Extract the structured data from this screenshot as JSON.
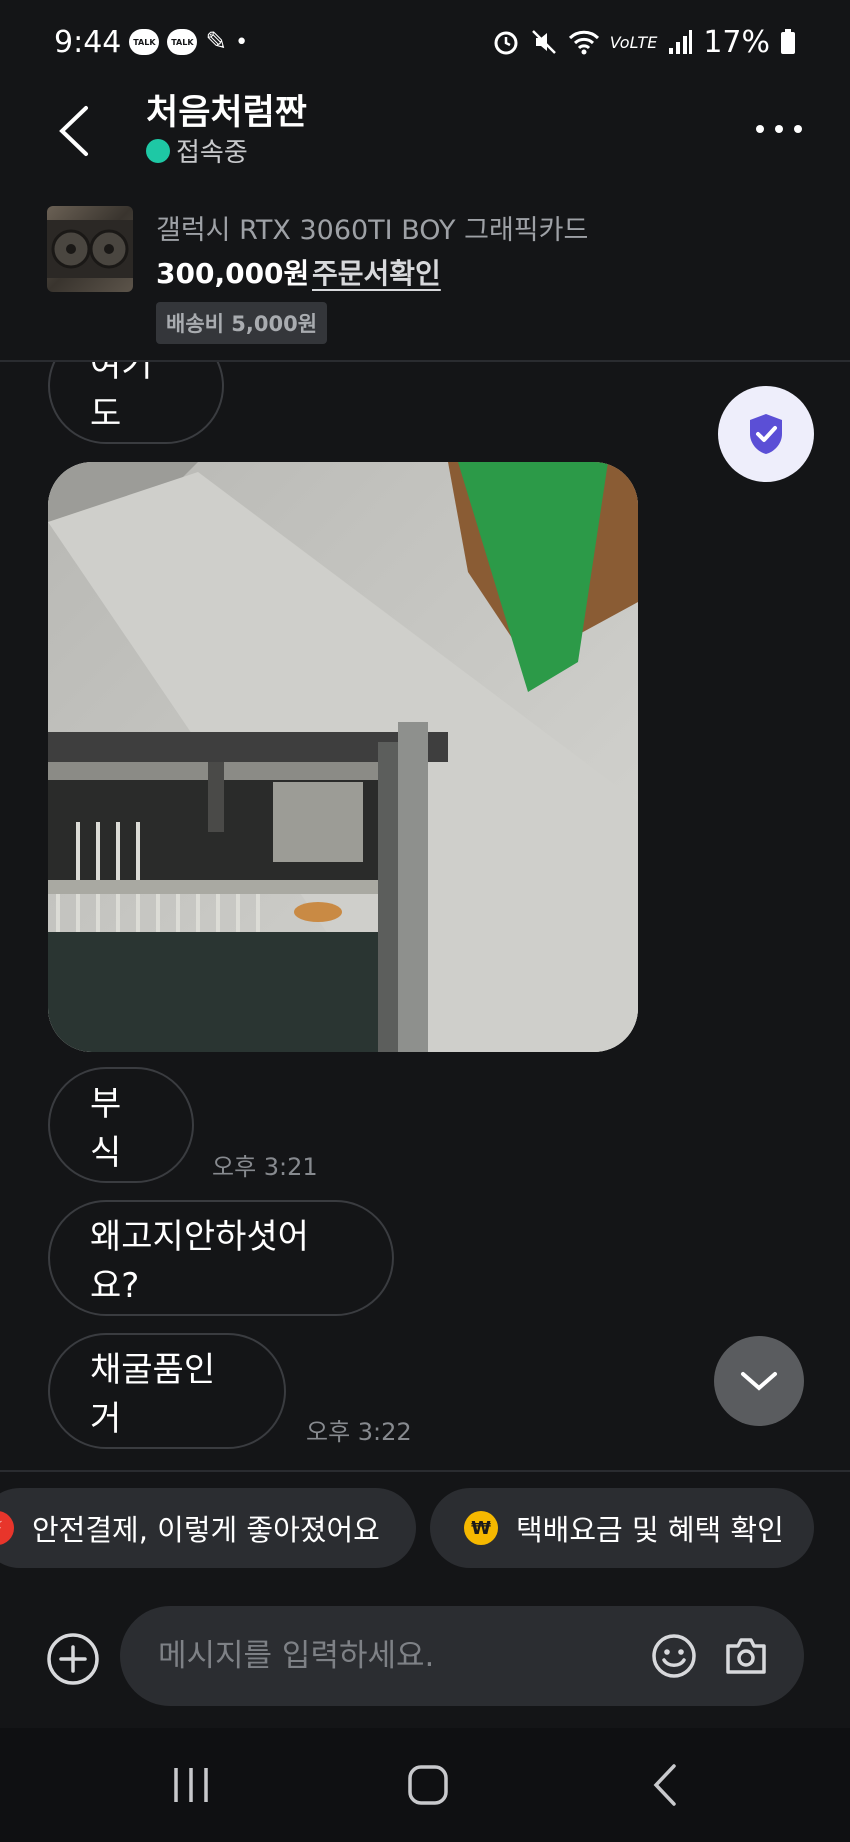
{
  "status_bar": {
    "time": "9:44",
    "notification_badges": [
      "TALK",
      "TALK"
    ],
    "dot": "•",
    "battery": "17%",
    "icons": [
      "alarm-icon",
      "mute-icon",
      "wifi-icon",
      "volte-icon",
      "signal-icon",
      "battery-icon"
    ]
  },
  "header": {
    "title": "처음처럼짠",
    "online_status": "접속중",
    "online_color": "#1ec8a5"
  },
  "product": {
    "name": "갤럭시 RTX 3060TI BOY 그래픽카드",
    "price": "300,000원",
    "order_link": "주문서확인",
    "shipping": "배송비 5,000원"
  },
  "messages": [
    {
      "text": "여기도"
    },
    {
      "text": "부식",
      "time": "오후 3:21"
    },
    {
      "text": "왜고지안하셧어요?"
    },
    {
      "text": "채굴품인거",
      "time": "오후 3:22"
    }
  ],
  "chips": [
    {
      "icon": "lightning-icon",
      "label": "안전결제, 이렇게 좋아졌어요"
    },
    {
      "icon": "won-icon",
      "label": "택배요금 및 혜택 확인"
    }
  ],
  "composer": {
    "placeholder": "메시지를 입력하세요."
  },
  "colors": {
    "background": "#141517",
    "accent_purple": "#5b4fd6",
    "won_yellow": "#f5b800",
    "lightning_red": "#e8352b"
  }
}
